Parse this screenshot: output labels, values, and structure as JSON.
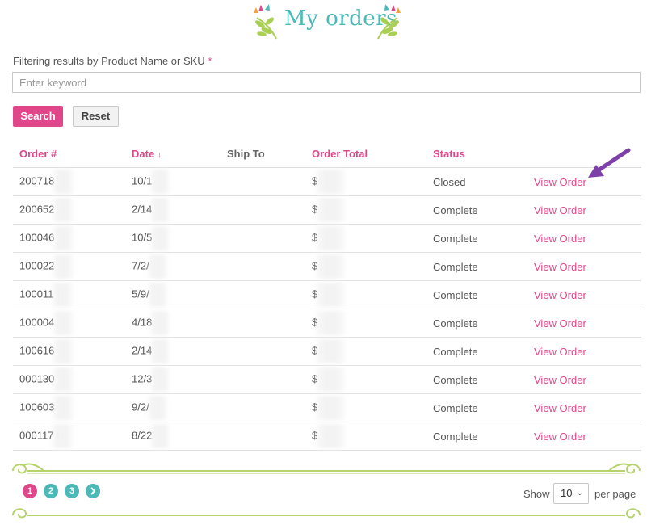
{
  "page": {
    "title": "My orders",
    "filter_label": "Filtering results by Product Name or SKU",
    "required_mark": "*",
    "search_placeholder": "Enter keyword",
    "search_value": ""
  },
  "buttons": {
    "search": "Search",
    "reset": "Reset"
  },
  "table": {
    "headers": {
      "order": "Order #",
      "date": "Date",
      "sort_arrow": "↓",
      "ship_to": "Ship To",
      "total": "Order Total",
      "status": "Status"
    },
    "rows": [
      {
        "order": "200718",
        "date": "10/1",
        "total": "$",
        "status": "Closed",
        "action": "View Order"
      },
      {
        "order": "200652",
        "date": "2/14",
        "total": "$",
        "status": "Complete",
        "action": "View Order"
      },
      {
        "order": "100046",
        "date": "10/5",
        "total": "$",
        "status": "Complete",
        "action": "View Order"
      },
      {
        "order": "100022",
        "date": "7/2/",
        "total": "$",
        "status": "Complete",
        "action": "View Order"
      },
      {
        "order": "100011",
        "date": "5/9/",
        "total": "$",
        "status": "Complete",
        "action": "View Order"
      },
      {
        "order": "100004",
        "date": "4/18",
        "total": "$",
        "status": "Complete",
        "action": "View Order"
      },
      {
        "order": "100616",
        "date": "2/14",
        "total": "$",
        "status": "Complete",
        "action": "View Order"
      },
      {
        "order": "000130",
        "date": "12/3",
        "total": "$",
        "status": "Complete",
        "action": "View Order"
      },
      {
        "order": "100603",
        "date": "9/2/",
        "total": "$",
        "status": "Complete",
        "action": "View Order"
      },
      {
        "order": "000117",
        "date": "8/22",
        "total": "$",
        "status": "Complete",
        "action": "View Order"
      }
    ]
  },
  "pagination": {
    "pages": [
      "1",
      "2",
      "3"
    ],
    "next_icon": "chevron-right-icon",
    "show_label": "Show",
    "per_page_value": "10",
    "per_page_label": "per page"
  },
  "colors": {
    "accent_pink": "#e0478a",
    "accent_teal": "#4cb8b8",
    "vine_green": "#b7d36b",
    "arrow_purple": "#7d3fa8"
  }
}
